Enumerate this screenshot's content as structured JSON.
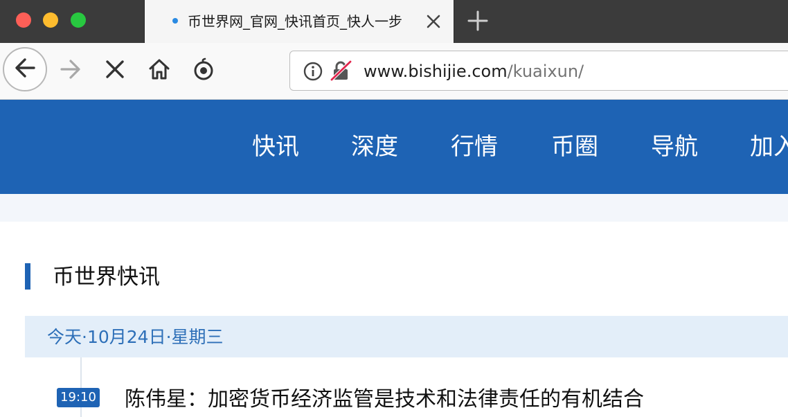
{
  "browser": {
    "tab": {
      "title": "币世界网_官网_快讯首页_快人一步"
    },
    "url": {
      "host": "www.bishijie.com",
      "path": "/kuaixun/"
    }
  },
  "icons": {
    "tab_close": "close-icon",
    "new_tab": "plus-icon",
    "back": "arrow-left-icon",
    "forward": "arrow-right-icon",
    "stop": "close-icon",
    "home": "home-icon",
    "extension": "extension-icon",
    "info": "info-icon",
    "insecure": "insecure-lock-icon"
  },
  "colors": {
    "brand_blue": "#1e63b4",
    "date_bg": "#e3eef9",
    "date_text": "#2d6fb8"
  },
  "nav": {
    "items": [
      "快讯",
      "深度",
      "行情",
      "币圈",
      "导航",
      "加入"
    ]
  },
  "section": {
    "title": "币世界快讯"
  },
  "feed": {
    "date": "今天·10月24日·星期三",
    "items": [
      {
        "time": "19:10",
        "headline": "陈伟星：加密货币经济监管是技术和法律责任的有机结合"
      }
    ]
  }
}
